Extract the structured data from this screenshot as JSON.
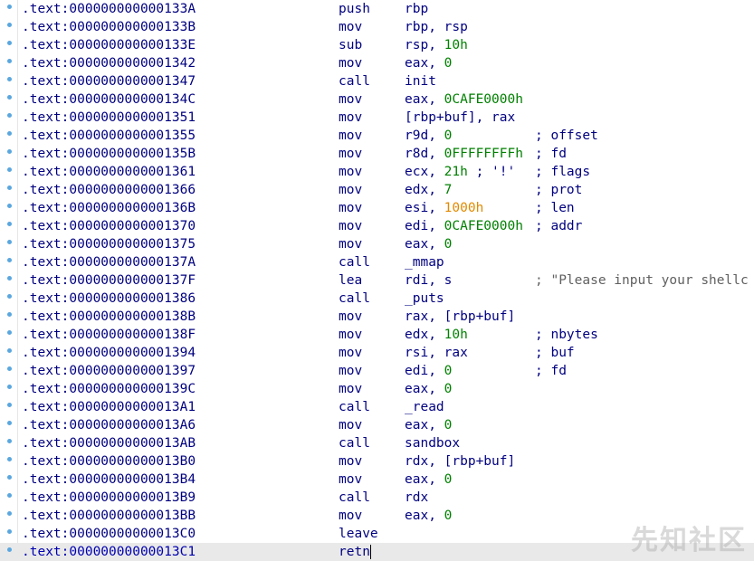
{
  "colors": {
    "text": "#000080",
    "immediate": "#008000",
    "highlight": "#e08a00",
    "comment_string": "#606060",
    "current_line_bg": "#e9e9e9",
    "gutter_dot": "#5aa7df"
  },
  "listing": [
    {
      "addr": ".text:000000000000133A",
      "mnem": "push",
      "ops": "rbp"
    },
    {
      "addr": ".text:000000000000133B",
      "mnem": "mov",
      "ops": "rbp, rsp"
    },
    {
      "addr": ".text:000000000000133E",
      "mnem": "sub",
      "ops": "rsp, ",
      "imm": "10h"
    },
    {
      "addr": ".text:0000000000001342",
      "mnem": "mov",
      "ops": "eax, ",
      "imm": "0"
    },
    {
      "addr": ".text:0000000000001347",
      "mnem": "call",
      "ops": "init"
    },
    {
      "addr": ".text:000000000000134C",
      "mnem": "mov",
      "ops": "eax, ",
      "imm": "0CAFE0000h"
    },
    {
      "addr": ".text:0000000000001351",
      "mnem": "mov",
      "ops": "[rbp+buf], rax"
    },
    {
      "addr": ".text:0000000000001355",
      "mnem": "mov",
      "ops": "r9d, ",
      "imm": "0",
      "comment": "; offset"
    },
    {
      "addr": ".text:000000000000135B",
      "mnem": "mov",
      "ops": "r8d, ",
      "imm": "0FFFFFFFFh",
      "comment": "; fd"
    },
    {
      "addr": ".text:0000000000001361",
      "mnem": "mov",
      "ops": "ecx, ",
      "imm": "21h",
      "tail": " ; '!'",
      "comment": "; flags"
    },
    {
      "addr": ".text:0000000000001366",
      "mnem": "mov",
      "ops": "edx, ",
      "imm": "7",
      "comment": "; prot"
    },
    {
      "addr": ".text:000000000000136B",
      "mnem": "mov",
      "ops": "esi, ",
      "hl": "1000h",
      "comment": "; len"
    },
    {
      "addr": ".text:0000000000001370",
      "mnem": "mov",
      "ops": "edi, ",
      "imm": "0CAFE0000h",
      "comment": "; addr"
    },
    {
      "addr": ".text:0000000000001375",
      "mnem": "mov",
      "ops": "eax, ",
      "imm": "0"
    },
    {
      "addr": ".text:000000000000137A",
      "mnem": "call",
      "ops": "_mmap"
    },
    {
      "addr": ".text:000000000000137F",
      "mnem": "lea",
      "ops": "rdi, s",
      "comment": "; \"Please input your shellc",
      "comment_string": true
    },
    {
      "addr": ".text:0000000000001386",
      "mnem": "call",
      "ops": "_puts"
    },
    {
      "addr": ".text:000000000000138B",
      "mnem": "mov",
      "ops": "rax, [rbp+buf]"
    },
    {
      "addr": ".text:000000000000138F",
      "mnem": "mov",
      "ops": "edx, ",
      "imm": "10h",
      "comment": "; nbytes"
    },
    {
      "addr": ".text:0000000000001394",
      "mnem": "mov",
      "ops": "rsi, rax",
      "comment": "; buf"
    },
    {
      "addr": ".text:0000000000001397",
      "mnem": "mov",
      "ops": "edi, ",
      "imm": "0",
      "comment": "; fd"
    },
    {
      "addr": ".text:000000000000139C",
      "mnem": "mov",
      "ops": "eax, ",
      "imm": "0"
    },
    {
      "addr": ".text:00000000000013A1",
      "mnem": "call",
      "ops": "_read"
    },
    {
      "addr": ".text:00000000000013A6",
      "mnem": "mov",
      "ops": "eax, ",
      "imm": "0"
    },
    {
      "addr": ".text:00000000000013AB",
      "mnem": "call",
      "ops": "sandbox"
    },
    {
      "addr": ".text:00000000000013B0",
      "mnem": "mov",
      "ops": "rdx, [rbp+buf]"
    },
    {
      "addr": ".text:00000000000013B4",
      "mnem": "mov",
      "ops": "eax, ",
      "imm": "0"
    },
    {
      "addr": ".text:00000000000013B9",
      "mnem": "call",
      "ops": "rdx"
    },
    {
      "addr": ".text:00000000000013BB",
      "mnem": "mov",
      "ops": "eax, ",
      "imm": "0"
    },
    {
      "addr": ".text:00000000000013C0",
      "mnem": "leave",
      "ops": ""
    },
    {
      "addr": ".text:00000000000013C1",
      "mnem": "retn",
      "ops": "",
      "current": true
    }
  ],
  "watermark": "先知社区"
}
